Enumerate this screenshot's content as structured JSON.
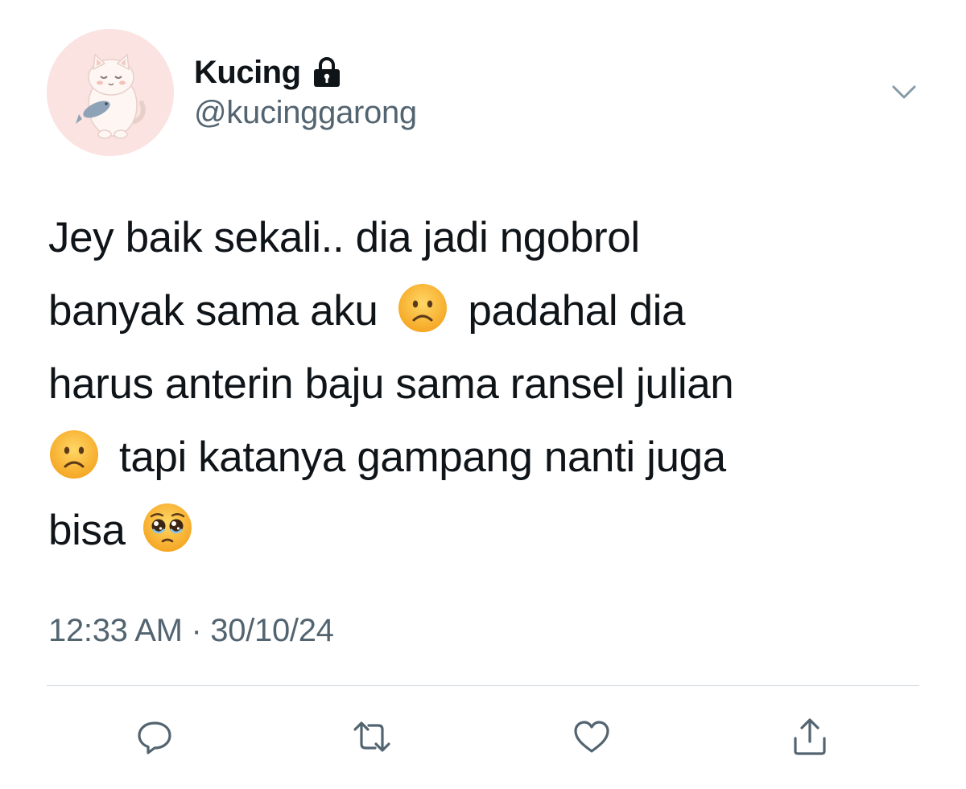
{
  "user": {
    "display_name": "Kucing",
    "handle": "@kucinggarong",
    "protected": true,
    "avatar_icon": "cat-holding-fish-avatar"
  },
  "tweet": {
    "lines": [
      "Jey baik sekali.. dia jadi ngobrol",
      "banyak sama aku",
      "padahal dia",
      "harus anterin baju sama ransel julian",
      "tapi katanya gampang nanti juga",
      "bisa"
    ],
    "emojis": [
      "frowning-face",
      "frowning-face",
      "pleading-face"
    ],
    "time": "12:33 AM",
    "separator": "·",
    "date": "30/10/24"
  },
  "actions": [
    {
      "name": "reply",
      "icon": "speech-bubble-icon"
    },
    {
      "name": "retweet",
      "icon": "retweet-arrows-icon"
    },
    {
      "name": "like",
      "icon": "heart-icon"
    },
    {
      "name": "share",
      "icon": "share-up-arrow-icon"
    }
  ],
  "colors": {
    "text_primary": "#0f1419",
    "text_secondary": "#536471",
    "icon": "#536471",
    "divider": "#cfd9de",
    "avatar_bg": "#fbe3e1"
  }
}
